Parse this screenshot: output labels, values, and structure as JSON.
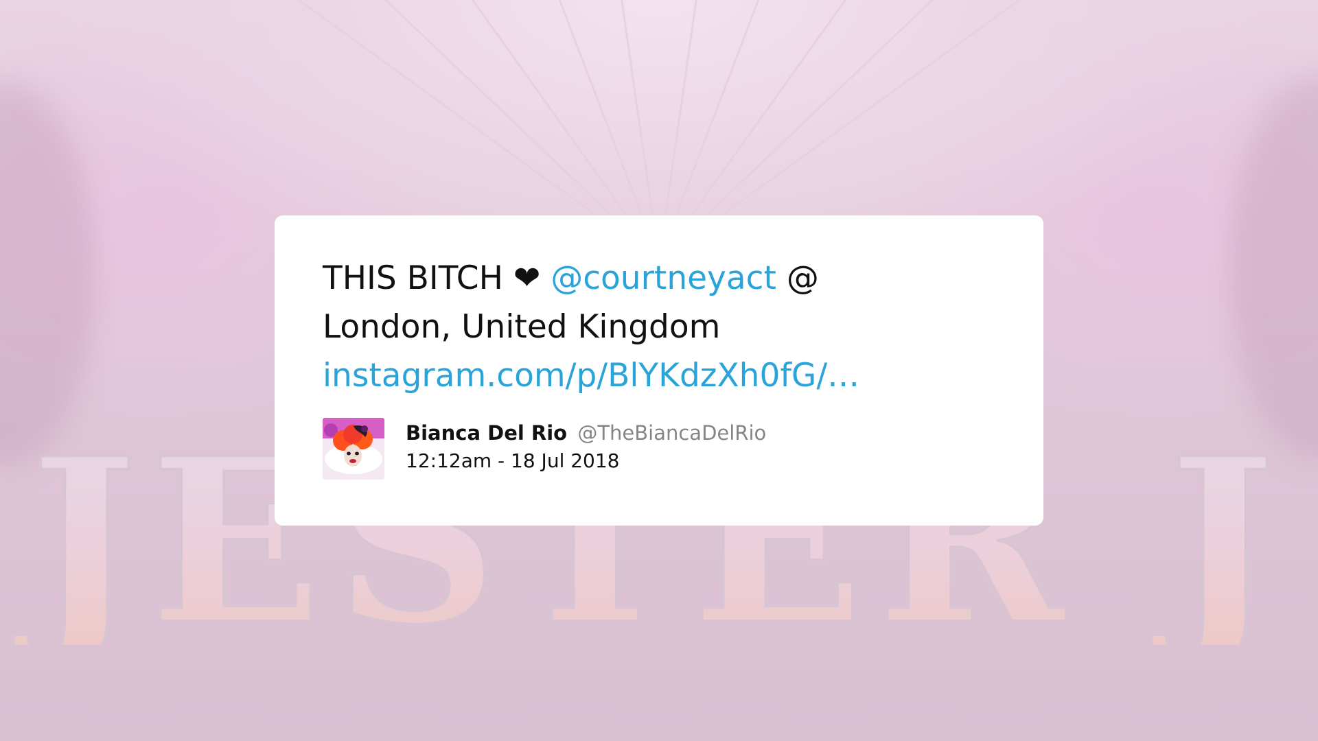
{
  "background": {
    "lettering": "JESTER J",
    "accent_color": "#ecd6e5"
  },
  "tweet": {
    "text_prefix": "THIS BITCH ",
    "heart": "❤",
    "mention": "@courtneyact",
    "text_middle": " @ London, United Kingdom",
    "url": "instagram.com/p/BlYKdzXh0fG/…",
    "link_color": "#2aa3d8"
  },
  "author": {
    "name": "Bianca Del Rio",
    "handle": "@TheBiancaDelRio",
    "timestamp": "12:12am - 18 Jul 2018",
    "avatar_icon": "avatar-icon"
  }
}
